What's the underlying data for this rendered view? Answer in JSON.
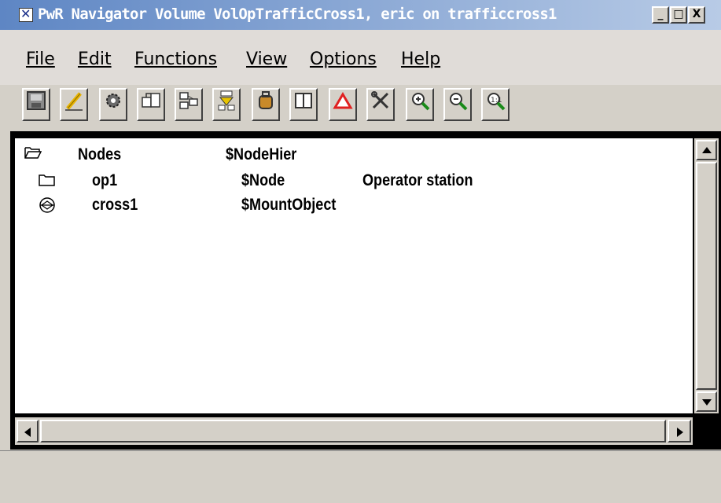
{
  "window": {
    "title": "PwR Navigator Volume VolOpTrafficCross1, eric on trafficcross1",
    "minimize_label": "_",
    "maximize_label": "□",
    "close_label": "X"
  },
  "menu": [
    {
      "label": "File"
    },
    {
      "label": "Edit"
    },
    {
      "label": "Functions"
    },
    {
      "label": "View"
    },
    {
      "label": "Options"
    },
    {
      "label": "Help"
    }
  ],
  "toolbar": [
    {
      "icon": "save-icon"
    },
    {
      "icon": "pencil-icon"
    },
    {
      "icon": "gear-icon"
    },
    {
      "icon": "copy-icon"
    },
    {
      "icon": "hierarchy-icon"
    },
    {
      "icon": "connect-icon"
    },
    {
      "icon": "package-icon"
    },
    {
      "icon": "window-icon"
    },
    {
      "icon": "alarm-triangle-icon"
    },
    {
      "icon": "tools-icon"
    },
    {
      "icon": "zoom-in-icon"
    },
    {
      "icon": "zoom-out-icon"
    },
    {
      "icon": "zoom-reset-icon"
    }
  ],
  "tree": [
    {
      "icon": "folder-open-icon",
      "name": "Nodes",
      "class": "$NodeHier",
      "description": ""
    },
    {
      "icon": "folder-icon",
      "name": "op1",
      "class": "$Node",
      "description": "Operator station"
    },
    {
      "icon": "mount-object-icon",
      "name": "cross1",
      "class": "$MountObject",
      "description": ""
    }
  ],
  "colors": {
    "title_gradient_start": "#5e86c4",
    "title_gradient_end": "#b8cbe6",
    "background": "#d4d0c8"
  }
}
